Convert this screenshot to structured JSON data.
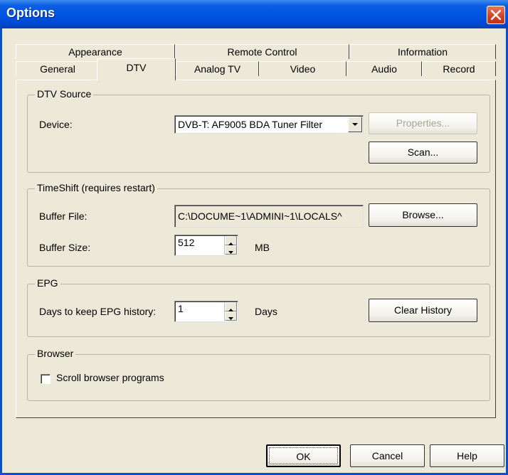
{
  "window": {
    "title": "Options",
    "close_label": "×"
  },
  "tabs_back": [
    {
      "label": "Appearance"
    },
    {
      "label": "Remote Control"
    },
    {
      "label": "Information"
    }
  ],
  "tabs_front": [
    {
      "label": "General"
    },
    {
      "label": "DTV",
      "selected": true
    },
    {
      "label": "Analog TV"
    },
    {
      "label": "Video"
    },
    {
      "label": "Audio"
    },
    {
      "label": "Record"
    }
  ],
  "dtv_source": {
    "legend": "DTV Source",
    "device_label": "Device:",
    "device_value": "DVB-T: AF9005 BDA Tuner Filter",
    "properties_button": "Properties...",
    "scan_button": "Scan..."
  },
  "timeshift": {
    "legend": "TimeShift (requires restart)",
    "buffer_file_label": "Buffer File:",
    "buffer_file_value": "C:\\DOCUME~1\\ADMINI~1\\LOCALS^",
    "browse_button": "Browse...",
    "buffer_size_label": "Buffer Size:",
    "buffer_size_value": "512",
    "buffer_size_unit": "MB"
  },
  "epg": {
    "legend": "EPG",
    "days_label": "Days to keep EPG history:",
    "days_value": "1",
    "days_unit": "Days",
    "clear_button": "Clear History"
  },
  "browser": {
    "legend": "Browser",
    "scroll_label": "Scroll browser programs",
    "scroll_checked": false
  },
  "footer": {
    "ok_button": "OK",
    "cancel_button": "Cancel",
    "help_button": "Help"
  },
  "colors": {
    "titlebar": "#0054e3",
    "close": "#d1411f",
    "face": "#ece9d8"
  }
}
